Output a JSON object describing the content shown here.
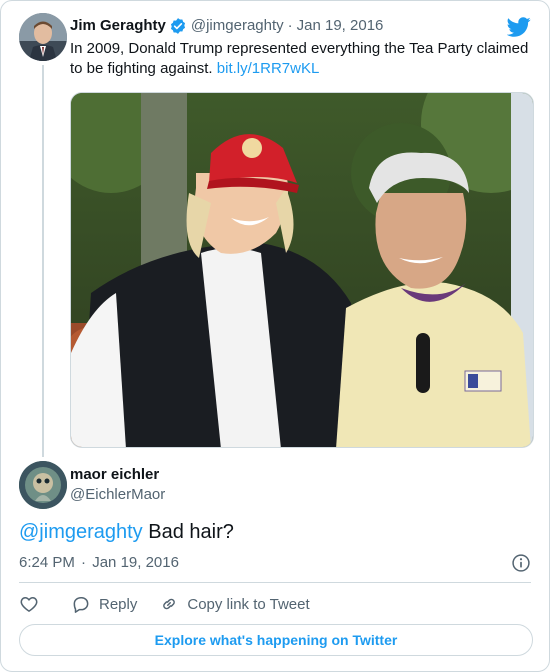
{
  "parent_tweet": {
    "display_name": "Jim Geraghty",
    "handle": "@jimgeraghty",
    "separator": "·",
    "date": "Jan 19, 2016",
    "text": "In 2009, Donald Trump represented everything the Tea Party claimed to be fighting against.",
    "link": "bit.ly/1RR7wKL",
    "verified_icon": "verified-badge-icon",
    "brand_icon": "twitter-bird-icon"
  },
  "reply_tweet": {
    "display_name": "maor eichler",
    "handle": "@EichlerMaor",
    "mention": "@jimgeraghty",
    "text": " Bad hair?",
    "time": "6:24 PM",
    "separator": "·",
    "date": "Jan 19, 2016",
    "info_icon": "info-icon"
  },
  "actions": {
    "like_icon": "heart-icon",
    "reply_label": "Reply",
    "copy_link_label": "Copy link to Tweet"
  },
  "explore_label": "Explore what's happening on Twitter",
  "colors": {
    "accent": "#1d9bf0",
    "muted_text": "#536471",
    "border": "#cfd9de"
  }
}
